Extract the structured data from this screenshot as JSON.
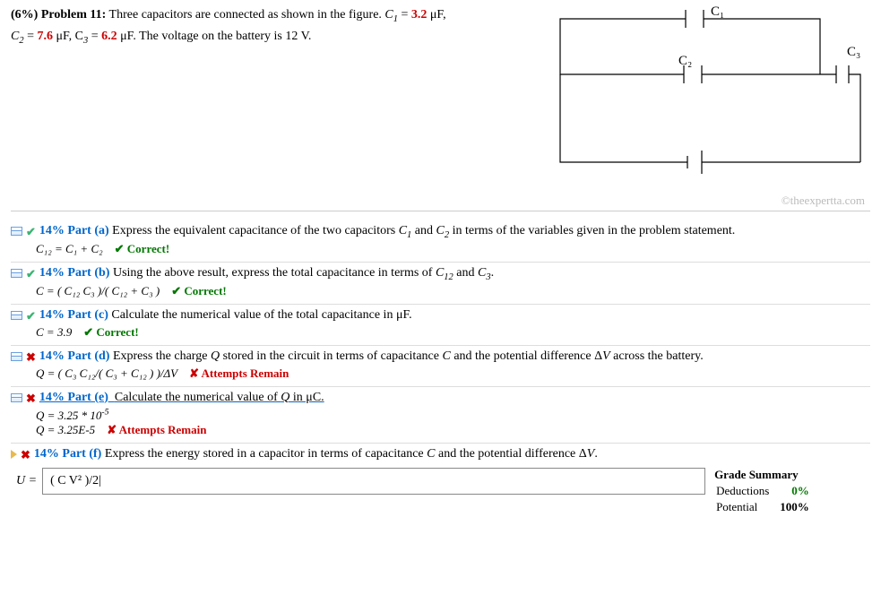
{
  "problem": {
    "prefix": "(6%)",
    "label": "Problem 11:",
    "text_before_c1": "Three capacitors are connected as shown in the figure. ",
    "c1_label": "C",
    "c1_sub": "1",
    "c1_eq": " = ",
    "c1_val": "3.2",
    "c1_unit": " μF,",
    "c2_pre": "C",
    "c2_sub": "2",
    "c2_eq": " = ",
    "c2_val": "7.6",
    "c3_pre": " μF, C",
    "c3_sub": "3",
    "c3_eq": " = ",
    "c3_val": "6.2",
    "tail": " μF. The voltage on the battery is 12 V."
  },
  "figure": {
    "c1": "C₁",
    "c2": "C₂",
    "c3": "C₃"
  },
  "watermark": "©theexpertta.com",
  "parts": {
    "a": {
      "pct": "14% Part (a)",
      "q": "Express the equivalent capacitance of the two capacitors ",
      "q_mid": " and ",
      "q_tail": " in terms of the variables given in the problem statement.",
      "ans": "C₁₂ = C₁ + C₂",
      "correct": "✔ Correct!"
    },
    "b": {
      "pct": "14% Part (b)",
      "q1": "Using the above result, express the total capacitance in terms of ",
      "q2": " and ",
      "q3": ".",
      "ans": "C = ( C₁₂ C₃ )/( C₁₂ + C₃ )",
      "correct": "✔ Correct!"
    },
    "c": {
      "pct": "14% Part (c)",
      "q": "Calculate the numerical value of the total capacitance in μF.",
      "ans": "C = 3.9",
      "correct": "✔ Correct!"
    },
    "d": {
      "pct": "14% Part (d)",
      "q1": "Express the charge ",
      "q2": " stored in the circuit in terms of capacitance ",
      "q3": " and the potential difference Δ",
      "q4": " across the battery.",
      "ans": "Q = ( C₃ C₁₂/( C₃ + C₁₂ ) )/ΔV",
      "attempts": "✘ Attempts Remain"
    },
    "e": {
      "pct": "14% Part (e)",
      "q": "Calculate the numerical value of ",
      "q2": " in μC.",
      "ans1_pre": "Q = 3.25 * 10",
      "ans1_sup": "-5",
      "ans2": "Q = 3.25E-5",
      "attempts": "✘ Attempts Remain"
    },
    "f": {
      "pct": "14% Part (f)",
      "q1": "Express the energy stored in a capacitor in terms of capacitance ",
      "q2": " and the potential difference Δ",
      "q3": ".",
      "lhs": "U = ",
      "input_value": "( C V² )/2|"
    }
  },
  "grade": {
    "title": "Grade Summary",
    "deductions_label": "Deductions",
    "deductions_val": "0%",
    "potential_label": "Potential",
    "potential_val": "100%"
  }
}
